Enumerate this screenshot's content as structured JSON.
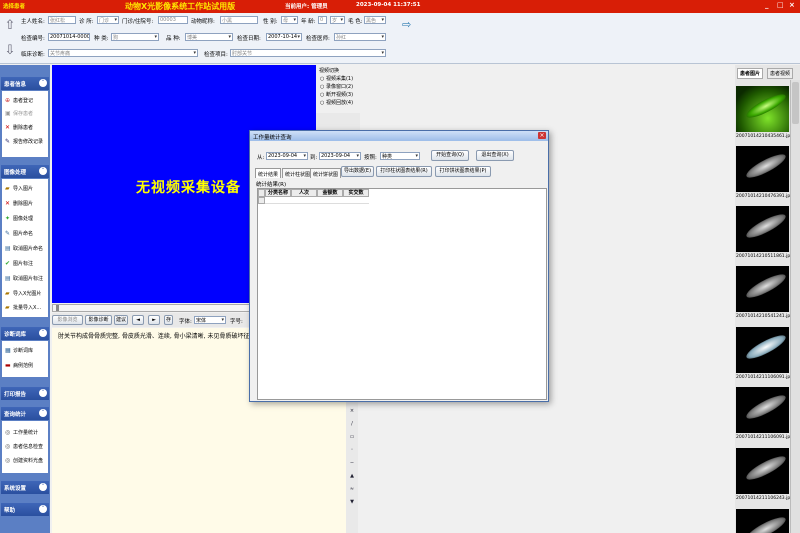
{
  "app": {
    "left_title": "选择患者",
    "title": "动物X光影像系统工作站试用版",
    "user": "当前用户: 管理员",
    "datetime": "2023-09-04 11:37:51"
  },
  "form": {
    "owner_label": "主人姓名:",
    "owner_placeholder": "张红松",
    "clinic_label": "诊 所:",
    "clinic_value": "门诊",
    "card_label": "门诊/住院号:",
    "card_value": "00003",
    "animal_label": "动物昵称:",
    "animal_value": "小黑",
    "sex_label": "性 别:",
    "sex_value": "母",
    "age_label": "年 龄:",
    "age_value": "0",
    "age_unit": "岁",
    "color_label": "毛 色:",
    "color_value": "黑色",
    "check_no_label": "检查编号:",
    "check_no_value": "20071014-000001",
    "species_label": "种 类:",
    "species_value": "狗",
    "breed_label": "品 种:",
    "breed_value": "博美",
    "date_label": "检查日期:",
    "date_value": "2007-10-14",
    "doctor_label": "检查医师:",
    "doctor_value": "孙红",
    "diag_label": "临床诊断:",
    "diag_value": "关节疼痛",
    "item_label": "检查项目:",
    "item_value": "肘部关节"
  },
  "sidebar": {
    "sections": [
      {
        "title": "患者信息",
        "items": [
          {
            "label": "患者登记",
            "icon": "register-icon"
          },
          {
            "label": "保存患者",
            "icon": "save-icon",
            "disabled": true
          },
          {
            "label": "删除患者",
            "icon": "delete-icon"
          },
          {
            "label": "报告修改记录",
            "icon": "report-history-icon"
          }
        ]
      },
      {
        "title": "图像处理",
        "items": [
          {
            "label": "导入图片",
            "icon": "import-icon"
          },
          {
            "label": "删除图片",
            "icon": "delete-icon"
          },
          {
            "label": "图像处理",
            "icon": "image-process-icon"
          },
          {
            "label": "图片命名",
            "icon": "rename-icon"
          },
          {
            "label": "取消图片命名",
            "icon": "cancel-rename-icon"
          },
          {
            "label": "图片标注",
            "icon": "check-icon"
          },
          {
            "label": "取消图片标注",
            "icon": "cancel-mark-icon"
          },
          {
            "label": "导入X光图片",
            "icon": "xray-import-icon"
          },
          {
            "label": "批量导入X...",
            "icon": "batch-import-icon"
          }
        ]
      },
      {
        "title": "诊断词库",
        "items": [
          {
            "label": "诊断词库",
            "icon": "dictionary-icon"
          },
          {
            "label": "病例范例",
            "icon": "case-icon"
          }
        ]
      },
      {
        "title": "打印报告",
        "items": []
      },
      {
        "title": "查询统计",
        "items": [
          {
            "label": "工作量统计",
            "icon": "stats-icon"
          },
          {
            "label": "患者信息检查",
            "icon": "patient-search-icon"
          },
          {
            "label": "创建资料光盘",
            "icon": "disc-icon"
          }
        ]
      },
      {
        "title": "系统设置",
        "items": []
      },
      {
        "title": "帮助",
        "items": []
      }
    ]
  },
  "video": {
    "no_device_text": "无视频采集设备",
    "switch_title": "视频切换",
    "options": [
      "视频采集(1)",
      "录像窗口(2)",
      "断开视频(3)",
      "视频回放(4)"
    ]
  },
  "toolbar": {
    "buttons": [
      "影像浏览",
      "影像诊断",
      "建议",
      "◄",
      "►",
      "存"
    ],
    "font_label": "字体:",
    "font_value": "宋体",
    "size_label": "字号:"
  },
  "report_text": "肘关节构成骨骨质完整, 骨皮质光滑、连续, 骨小梁清晰, 未见骨质破坏征象, 关节间隙等宽, 关节关系正常。",
  "right_panel": {
    "tabs": [
      "患者图片",
      "患者视频"
    ],
    "thumbnails": [
      {
        "caption": "20071014210435461.jpg",
        "style": "green"
      },
      {
        "caption": "20071014210476391.jpg",
        "style": "xray"
      },
      {
        "caption": "20071014210511861.jpg",
        "style": "xray"
      },
      {
        "caption": "20071014210541241.jpg",
        "style": "xray"
      },
      {
        "caption": "20071014211106091.jpg",
        "style": "xray"
      },
      {
        "caption": "20071014211106091.jpg",
        "style": "xray"
      },
      {
        "caption": "20071014211106243.jpg",
        "style": "xray"
      },
      {
        "caption": "",
        "style": "xray"
      }
    ]
  },
  "dialog": {
    "title": "工作量统计查询",
    "from_label": "从:",
    "from_value": "2023-09-04",
    "to_label": "到:",
    "to_value": "2023-09-04",
    "group_label": "按照:",
    "group_value": "种类",
    "query_button": "开始查询(Q)",
    "exit_button": "退出查询(X)",
    "tabs": [
      "统计结果",
      "统计柱状图",
      "统计饼状图"
    ],
    "export_button": "导出数据(E)",
    "print_bar_button": "打印柱状图表结果(R)",
    "print_pie_button": "打印饼状图表结果(P)",
    "result_label": "统计结果(R)",
    "columns": [
      "分类名称",
      "人次",
      "金额数",
      "实交数"
    ]
  }
}
